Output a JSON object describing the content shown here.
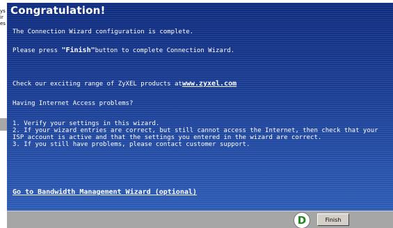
{
  "background": {
    "fragments": [
      "ys",
      "ir",
      "es"
    ]
  },
  "window": {
    "title": "Congratulation!"
  },
  "content": {
    "complete_text": "The Connection Wizard configuration is complete.",
    "press_prefix": "Please press ",
    "press_bold": "\"Finish\"",
    "press_suffix": "button to complete Connection Wizard.",
    "check_prefix": "Check our exciting range of ZyXEL products at",
    "zyxel_link": "www.zyxel.com",
    "problems_heading": "Having Internet Access problems?",
    "step1": "1. Verify your settings in this wizard.",
    "step2a": "2. If your wizard entries are correct, but still cannot access the Internet, then check that your",
    "step2b": "ISP account is active and that the settings you entered in the wizard are correct.",
    "step3": "3. If you still have problems, please contact customer support.",
    "bandwidth_link": "Go to Bandwidth Management Wizard (optional)"
  },
  "footer": {
    "badge_label": "D",
    "finish_label": "Finish"
  },
  "colors": {
    "panel_blue": "#1f3f8f",
    "footer_gray": "#a6a6a6",
    "badge_green": "#1d8a1d"
  }
}
